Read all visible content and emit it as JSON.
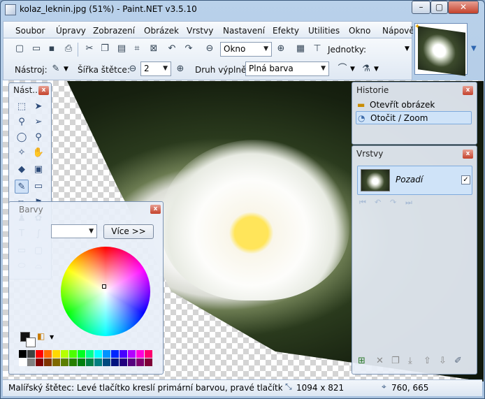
{
  "window": {
    "title": "kolaz_leknin.jpg (51%) - Paint.NET v3.5.10",
    "buttons": {
      "minimize": "–",
      "maximize": "▢",
      "close": "✕"
    }
  },
  "menu": [
    "Soubor",
    "Úpravy",
    "Zobrazení",
    "Obrázek",
    "Vrstvy",
    "Nastavení",
    "Efekty",
    "Utilities",
    "Okno",
    "Nápověda"
  ],
  "toolbar": {
    "zoom_value": "Okno",
    "units_label": "Jednotky:",
    "tool_label": "Nástroj:",
    "brush_width_label": "Šířka štětce:",
    "brush_width_value": "2",
    "fill_label": "Druh výplně:",
    "fill_value": "Plná barva"
  },
  "tools_panel": {
    "title": "Nást..."
  },
  "colors_panel": {
    "title": "Barvy",
    "more_button": "Více >>"
  },
  "history_panel": {
    "title": "Historie",
    "items": [
      "Otevřít obrázek",
      "Otočit / Zoom"
    ]
  },
  "layers_panel": {
    "title": "Vrstvy",
    "layer_name": "Pozadí",
    "layer_visible": true
  },
  "status": {
    "hint": "Malířský štětec: Levé tlačítko kreslí primární barvou, pravé tlačítko sekund...",
    "image_size": "1094 x 821",
    "cursor_pos": "760, 665"
  },
  "colors": {
    "accent": "#3399ff",
    "title_bg": "#b9d1ea"
  }
}
